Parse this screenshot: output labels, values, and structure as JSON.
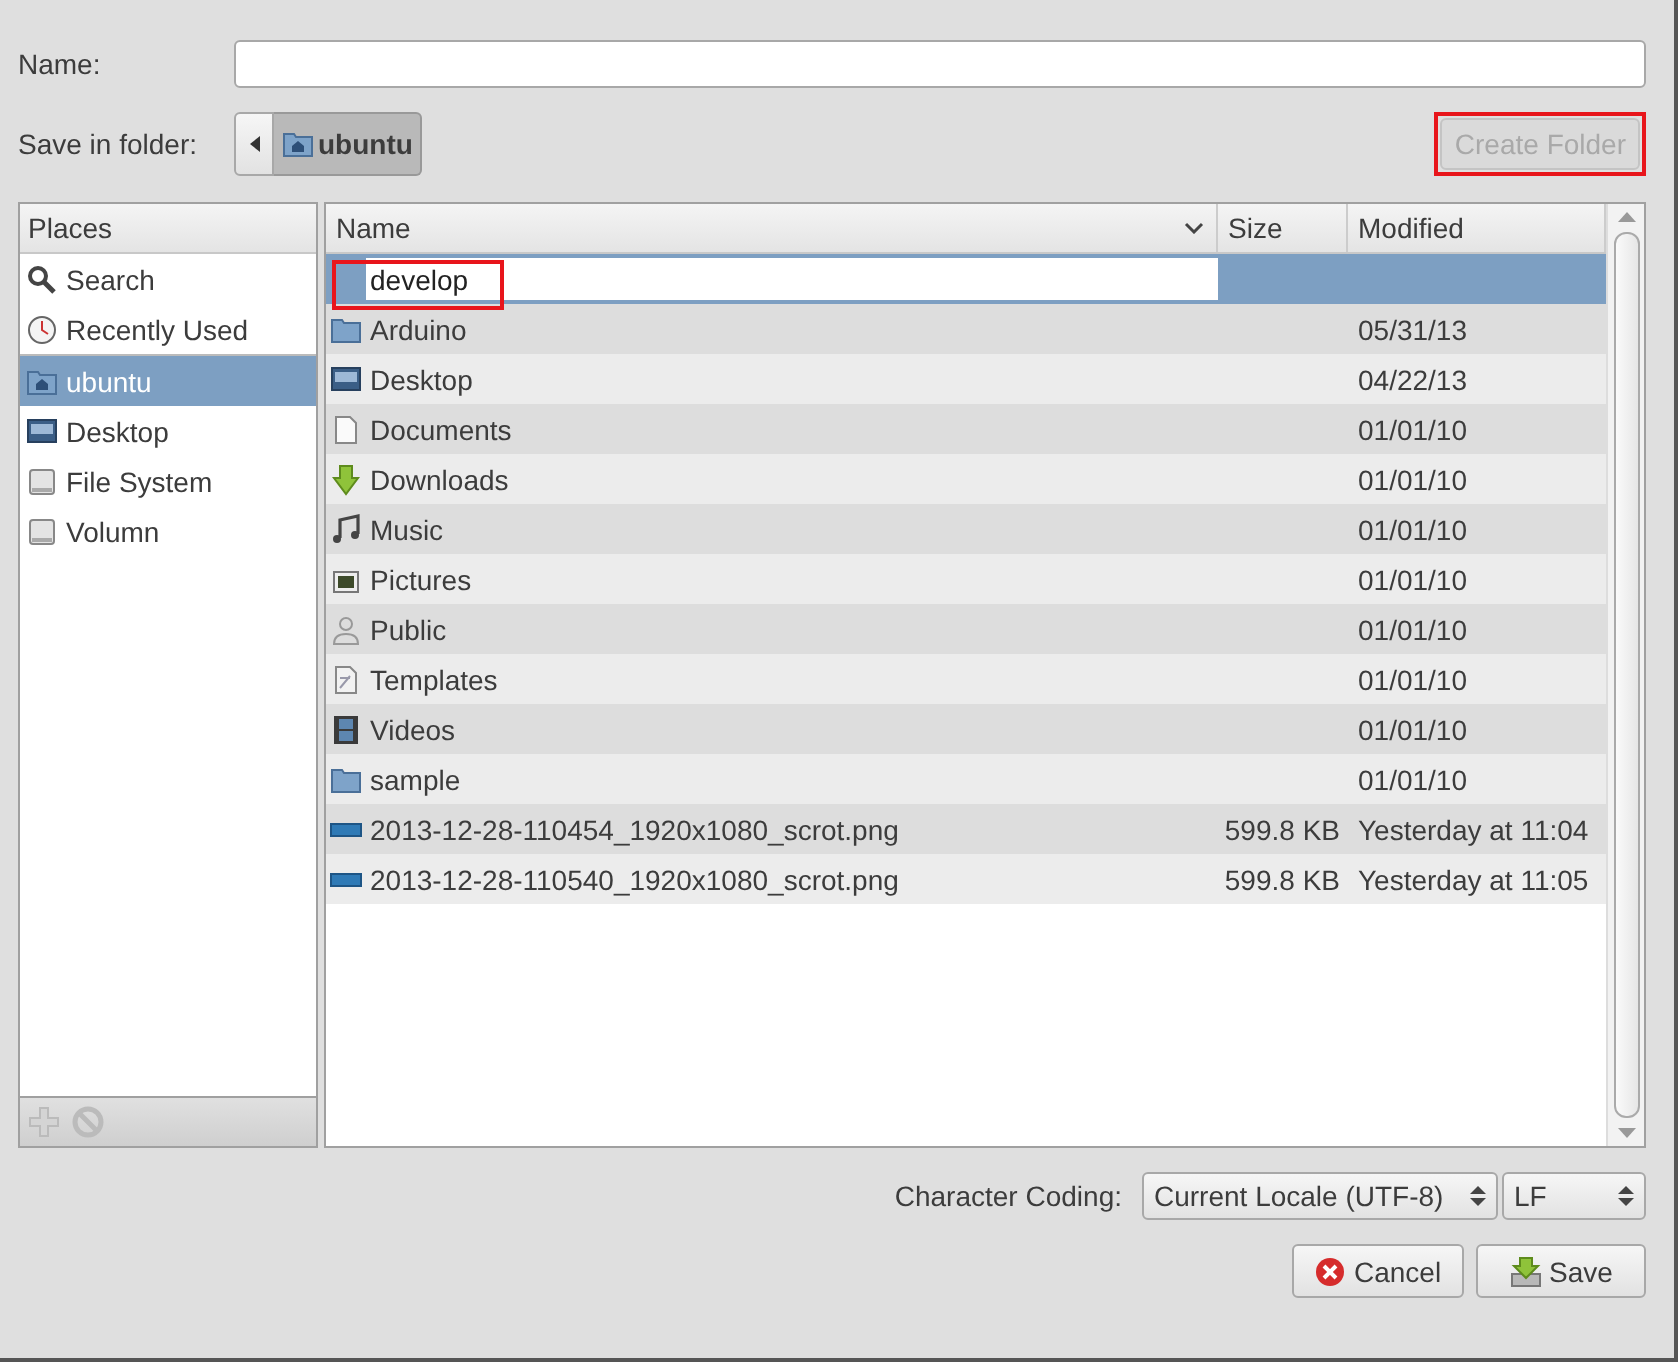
{
  "name_field": {
    "label": "Name:"
  },
  "save_in": {
    "label": "Save in folder:",
    "path": [
      {
        "label": "ubuntu",
        "kind": "home",
        "selected": true
      }
    ]
  },
  "create_folder": {
    "label": "Create Folder",
    "disabled": true,
    "highlighted": true
  },
  "places": {
    "title": "Places",
    "sections": [
      {
        "items": [
          {
            "label": "Search",
            "kind": "search",
            "selected": false
          },
          {
            "label": "Recently Used",
            "kind": "recent",
            "selected": false
          }
        ]
      },
      {
        "items": [
          {
            "label": "ubuntu",
            "kind": "home",
            "selected": true
          },
          {
            "label": "Desktop",
            "kind": "desktop",
            "selected": false
          },
          {
            "label": "File System",
            "kind": "drive",
            "selected": false
          },
          {
            "label": "Volumn",
            "kind": "drive",
            "selected": false
          }
        ]
      }
    ]
  },
  "file_list": {
    "columns": [
      "Name",
      "Size",
      "Modified"
    ],
    "new_folder": {
      "value": "develop",
      "selected": true,
      "highlighted": true
    },
    "rows": [
      {
        "name": "Arduino",
        "kind": "folder",
        "modified": "05/31/13",
        "selected": false
      },
      {
        "name": "Desktop",
        "kind": "desktop",
        "modified": "04/22/13",
        "selected": false
      },
      {
        "name": "Documents",
        "kind": "documents",
        "modified": "01/01/10",
        "selected": false
      },
      {
        "name": "Downloads",
        "kind": "downloads",
        "modified": "01/01/10",
        "selected": false
      },
      {
        "name": "Music",
        "kind": "music",
        "modified": "01/01/10",
        "selected": false
      },
      {
        "name": "Pictures",
        "kind": "pictures",
        "modified": "01/01/10",
        "selected": false
      },
      {
        "name": "Public",
        "kind": "public",
        "modified": "01/01/10",
        "selected": false
      },
      {
        "name": "Templates",
        "kind": "templates",
        "modified": "01/01/10",
        "selected": false
      },
      {
        "name": "Videos",
        "kind": "videos",
        "modified": "01/01/10",
        "selected": false
      },
      {
        "name": "sample",
        "kind": "folder",
        "modified": "01/01/10",
        "selected": false
      },
      {
        "name": "2013-12-28-110454_1920x1080_scrot.png",
        "kind": "image",
        "size": "599.8 KB",
        "modified": "Yesterday at 11:04",
        "selected": false
      },
      {
        "name": "2013-12-28-110540_1920x1080_scrot.png",
        "kind": "image",
        "size": "599.8 KB",
        "modified": "Yesterday at 11:05",
        "selected": false
      }
    ]
  },
  "character_coding": {
    "label": "Character Coding:",
    "encoding": "Current Locale (UTF-8)",
    "line_ending": "LF"
  },
  "buttons": [
    {
      "label": "Cancel",
      "kind": "cancel"
    },
    {
      "label": "Save",
      "kind": "save"
    }
  ]
}
